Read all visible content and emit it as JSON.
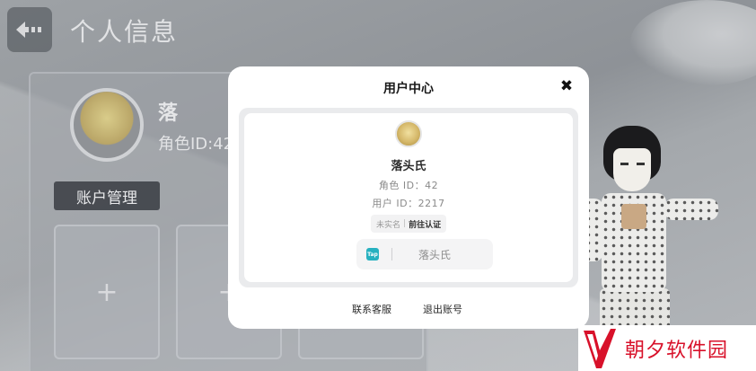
{
  "page": {
    "title": "个人信息",
    "back_icon": "back-arrow-icon",
    "profile_name": "落",
    "role_id_prefix": "角色ID:42",
    "account_section": "账户管理",
    "slots": [
      "+",
      "+"
    ]
  },
  "modal": {
    "title": "用户中心",
    "close_glyph": "✖",
    "user": {
      "name": "落头氏",
      "role_id": "角色 ID：42",
      "user_id": "用户 ID：2217"
    },
    "verify": {
      "status": "未实名",
      "separator": "|",
      "action": "前往认证"
    },
    "taptap": {
      "icon_label": "Tap",
      "name": "落头氏"
    },
    "links": {
      "support": "联系客服",
      "logout": "退出账号"
    }
  },
  "watermark": {
    "text": "朝夕软件园",
    "brand_color": "#d8112a"
  }
}
